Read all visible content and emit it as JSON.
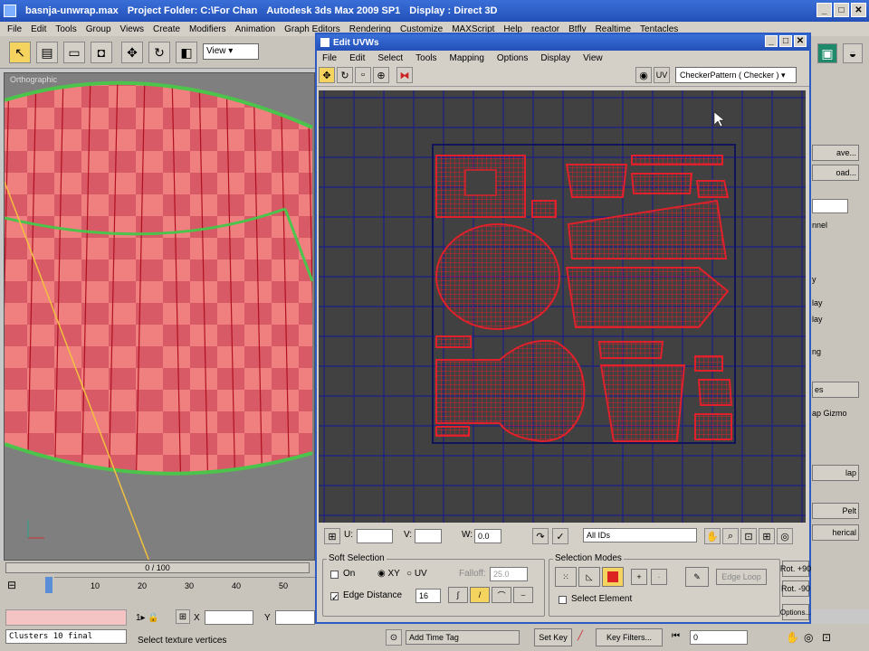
{
  "window": {
    "file": "basnja-unwrap.max",
    "project": "Project Folder: C:\\For Chan",
    "app": "Autodesk 3ds Max  2009 SP1",
    "display": "Display : Direct 3D"
  },
  "menu": [
    "File",
    "Edit",
    "Tools",
    "Group",
    "Views",
    "Create",
    "Modifiers",
    "Animation",
    "Graph Editors",
    "Rendering",
    "Customize",
    "MAXScript",
    "Help",
    "reactor",
    "Btfly",
    "Realtime",
    "Tentacles"
  ],
  "toolbar": {
    "view_dropdown": "View"
  },
  "viewport": {
    "label": "Orthographic"
  },
  "uvw": {
    "title": "Edit UVWs",
    "menu": [
      "File",
      "Edit",
      "Select",
      "Tools",
      "Mapping",
      "Options",
      "Display",
      "View"
    ],
    "texture_dropdown": "CheckerPattern  ( Checker )",
    "u_label": "U:",
    "v_label": "V:",
    "w_label": "W:",
    "w_value": "0.0",
    "ids_dropdown": "All IDs",
    "soft_selection": {
      "title": "Soft Selection",
      "on_label": "On",
      "xy_label": "XY",
      "uv_label": "UV",
      "falloff_label": "Falloff:",
      "falloff_value": "25.0",
      "edge_distance_label": "Edge Distance",
      "edge_distance_value": "16"
    },
    "selection_modes": {
      "title": "Selection Modes",
      "edge_loop": "Edge Loop",
      "select_element": "Select Element"
    },
    "rot_plus": "Rot. +90",
    "rot_minus": "Rot. -90",
    "options": "Options..."
  },
  "cmdpanel": {
    "save": "ave...",
    "load": "oad...",
    "channel": "nnel",
    "gizmo": "ap Gizmo",
    "map": "lap",
    "pelt": "Pelt",
    "spherical": "herical",
    "y1": "y",
    "lay": "lay",
    "ng": "ng",
    "es": "es"
  },
  "timeline": {
    "frame": "0 / 100",
    "ticks": [
      "10",
      "20",
      "30",
      "40",
      "50"
    ]
  },
  "status": {
    "clusters": "Clusters 10 final",
    "prompt": "Select texture vertices",
    "x_label": "X",
    "y_label": "Y",
    "add_time_tag": "Add Time Tag",
    "set_key": "Set Key",
    "key_filters": "Key Filters...",
    "frame_value": "0"
  },
  "colors": {
    "title_blue": "#2c5bc4",
    "uv_red": "#e0202a",
    "grid_blue": "#1b1f8a",
    "canvas_gray": "#414141",
    "mesh_pink": "#f08080"
  }
}
